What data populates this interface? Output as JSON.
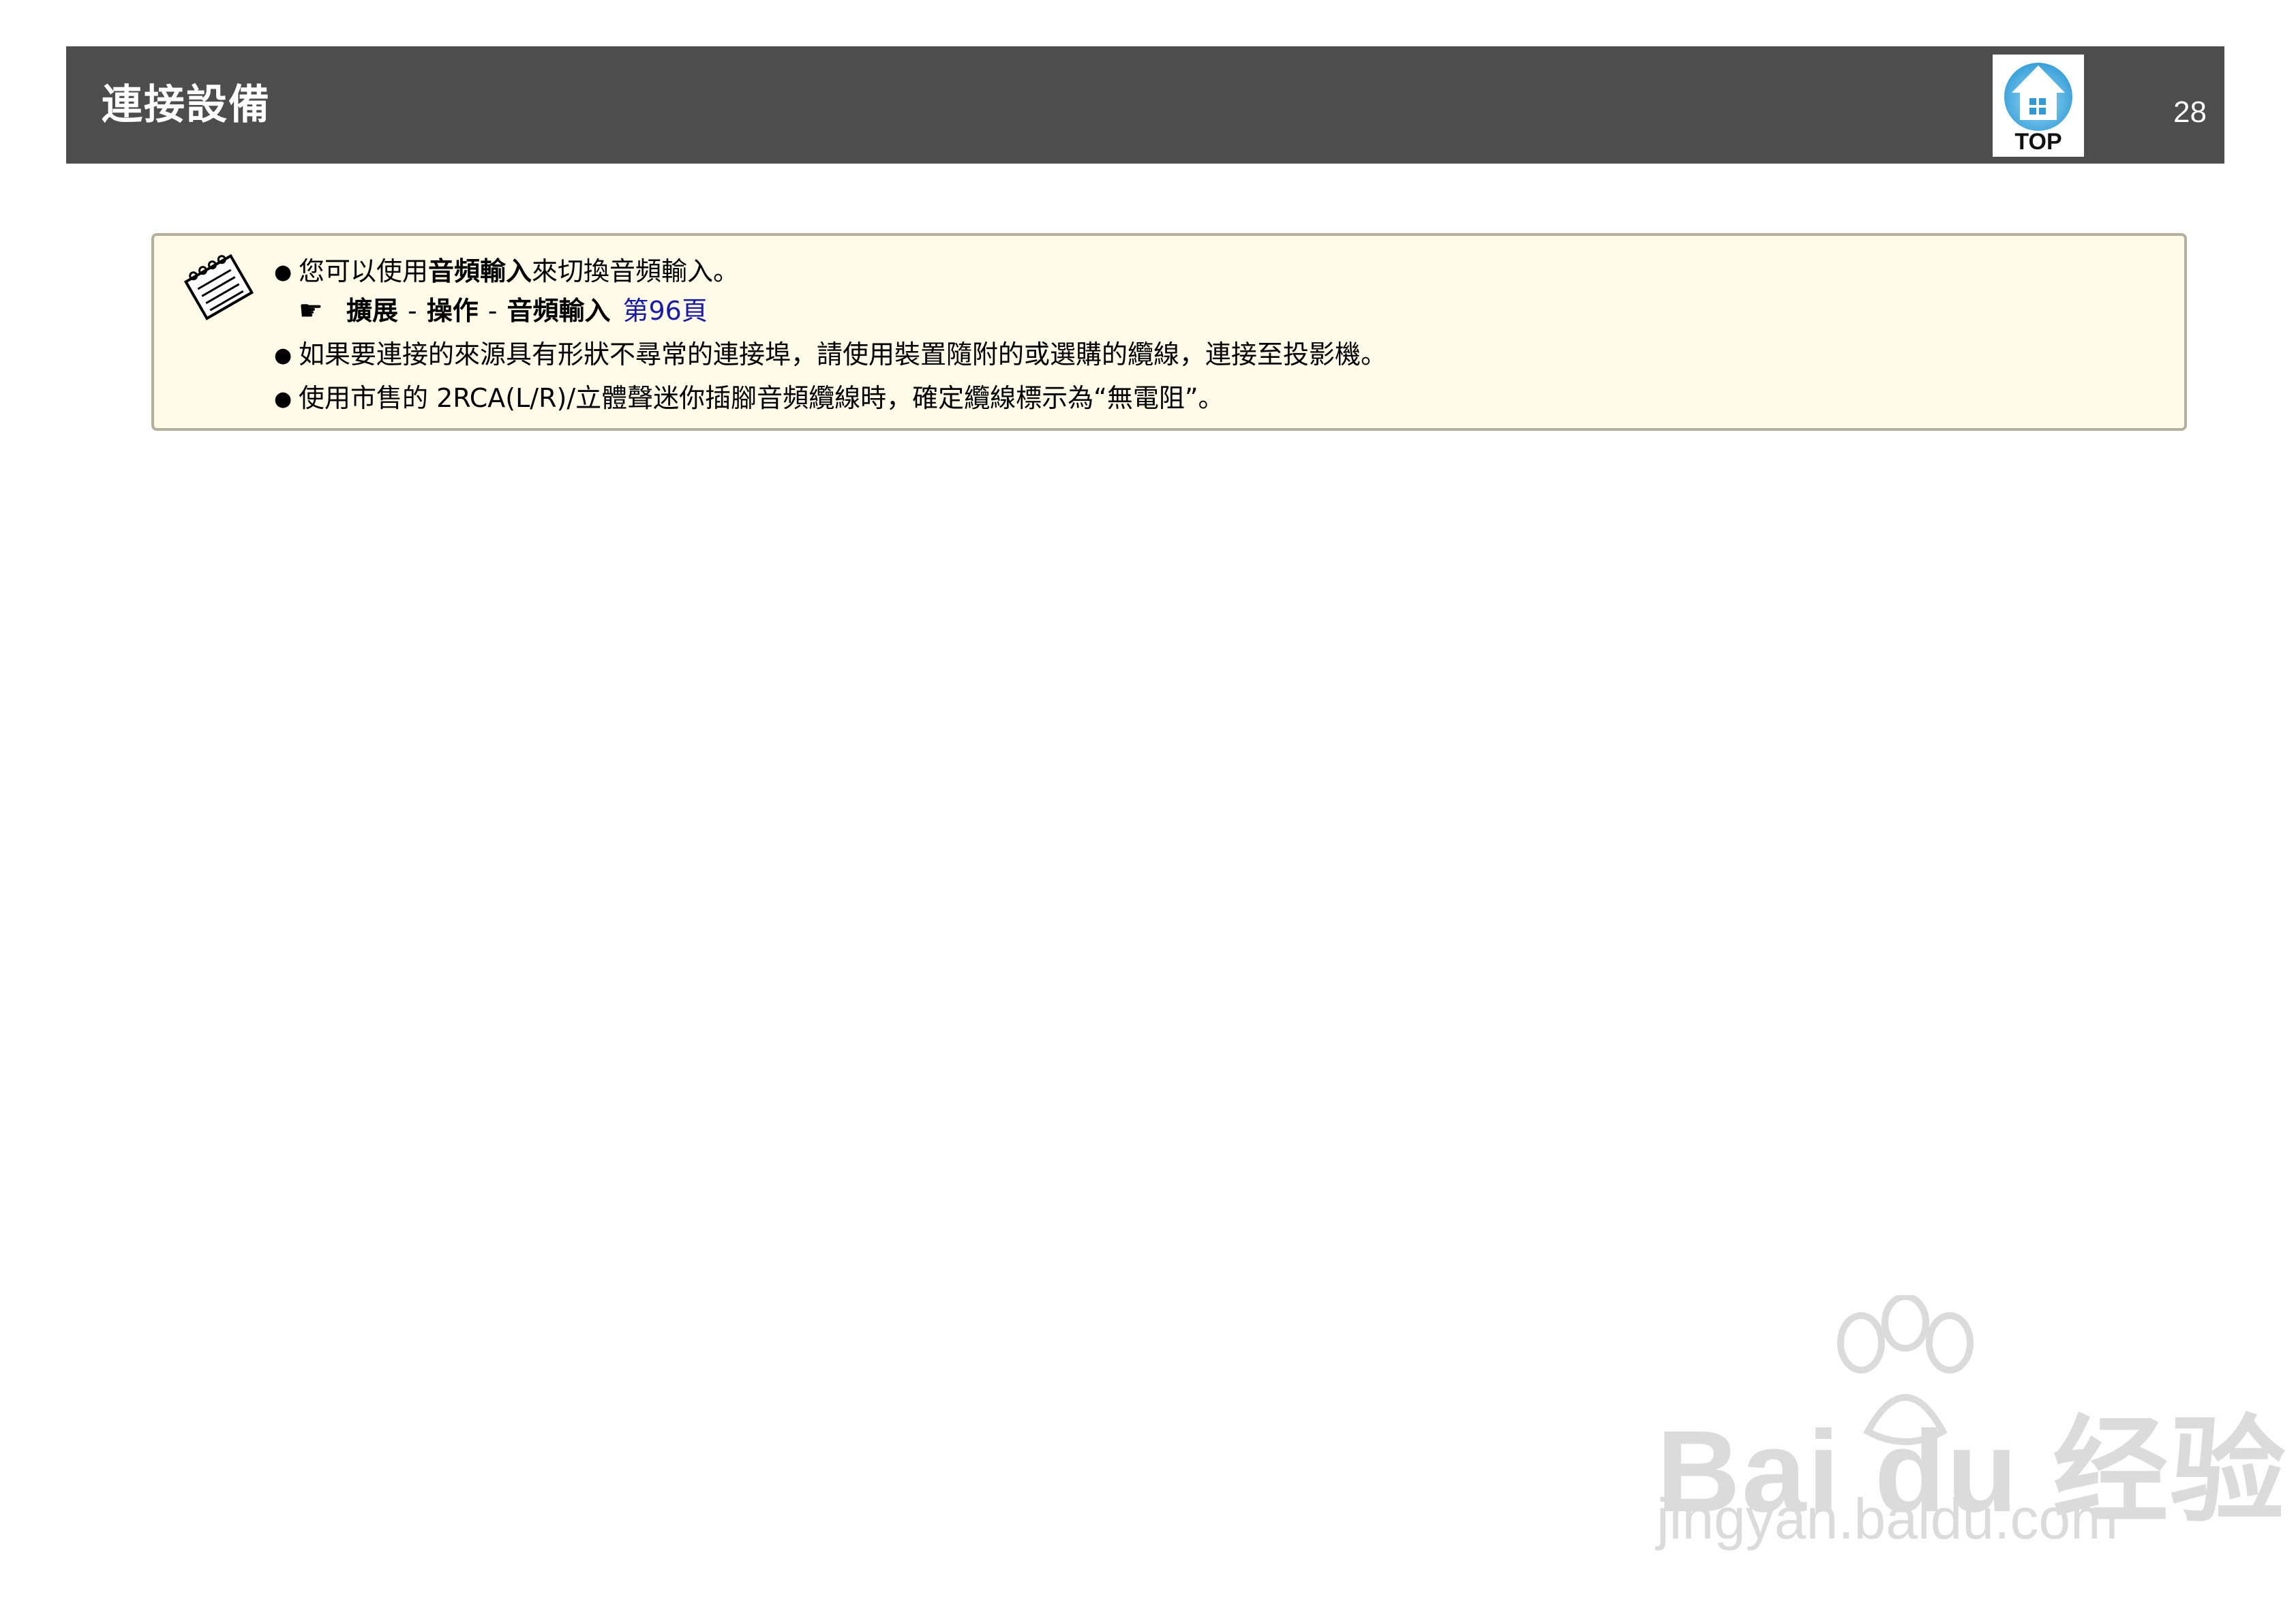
{
  "header": {
    "title": "連接設備",
    "top_button_label": "TOP",
    "page_number": "28"
  },
  "note": {
    "icon": "notepad-icon",
    "item1": {
      "prefix": "您可以使用",
      "bold": "音頻輸入",
      "suffix": "來切換音頻輸入。"
    },
    "reference": {
      "icon": "pointing-hand-icon",
      "path": [
        "擴展",
        "操作",
        "音頻輸入"
      ],
      "separator": "-",
      "link": "第96頁"
    },
    "item2": "如果要連接的來源具有形狀不尋常的連接埠，請使用裝置隨附的或選購的纜線，連接至投影機。",
    "item3": "使用市售的 2RCA(L/R)/立體聲迷你插腳音頻纜線時，確定纜線標示為“無電阻”。"
  },
  "watermark": {
    "brand": "Bai du 经验",
    "url": "jingyan.baidu.com"
  },
  "colors": {
    "header_bg": "#4d4d4d",
    "note_bg": "#fefbe9",
    "note_border": "#b5b09c",
    "link": "#1a1aa8",
    "top_icon": "#3aa6dc"
  }
}
